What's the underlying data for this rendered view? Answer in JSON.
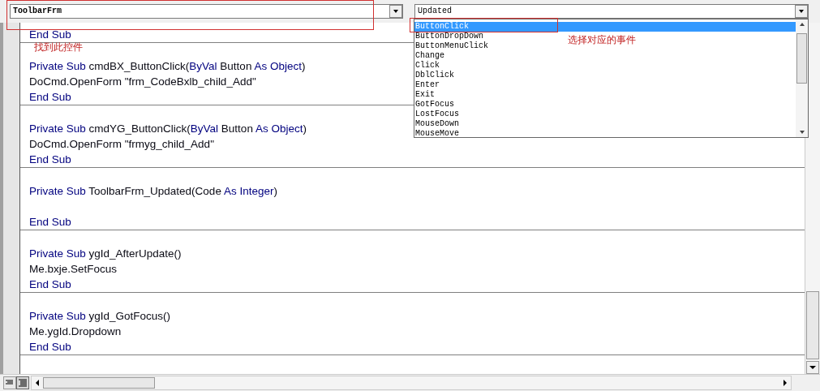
{
  "object_combo": {
    "value": "ToolbarFrm"
  },
  "event_combo": {
    "value": "Updated"
  },
  "event_list": [
    {
      "label": "ButtonClick",
      "selected": true
    },
    {
      "label": "ButtonDropDown",
      "selected": false
    },
    {
      "label": "ButtonMenuClick",
      "selected": false
    },
    {
      "label": "Change",
      "selected": false
    },
    {
      "label": "Click",
      "selected": false
    },
    {
      "label": "DblClick",
      "selected": false
    },
    {
      "label": "Enter",
      "selected": false
    },
    {
      "label": "Exit",
      "selected": false
    },
    {
      "label": "GotFocus",
      "selected": false
    },
    {
      "label": "LostFocus",
      "selected": false
    },
    {
      "label": "MouseDown",
      "selected": false
    },
    {
      "label": "MouseMove",
      "selected": false
    }
  ],
  "annotations": [
    {
      "text": "找到此控件"
    },
    {
      "text": "选择对应的事件"
    }
  ],
  "code_blocks": [
    {
      "kind": "fragment",
      "lines": [
        {
          "kind": "code",
          "segments": [
            {
              "text": "End Sub",
              "kind": "keyword"
            }
          ]
        }
      ]
    },
    {
      "kind": "procedure",
      "lines": [
        {
          "kind": "code",
          "segments": [
            {
              "text": "Private Sub",
              "kind": "keyword"
            },
            {
              "text": " cmdBX_ButtonClick(",
              "kind": "plain"
            },
            {
              "text": "ByVal",
              "kind": "keyword"
            },
            {
              "text": " Button ",
              "kind": "plain"
            },
            {
              "text": "As Object",
              "kind": "keyword"
            },
            {
              "text": ")",
              "kind": "plain"
            }
          ]
        },
        {
          "kind": "code",
          "segments": [
            {
              "text": "DoCmd.OpenForm \"frm_CodeBxlb_child_Add\"",
              "kind": "plain"
            }
          ]
        },
        {
          "kind": "code",
          "segments": [
            {
              "text": "End Sub",
              "kind": "keyword"
            }
          ]
        }
      ]
    },
    {
      "kind": "procedure",
      "lines": [
        {
          "kind": "code",
          "segments": [
            {
              "text": "Private Sub",
              "kind": "keyword"
            },
            {
              "text": " cmdYG_ButtonClick(",
              "kind": "plain"
            },
            {
              "text": "ByVal",
              "kind": "keyword"
            },
            {
              "text": " Button ",
              "kind": "plain"
            },
            {
              "text": "As Object",
              "kind": "keyword"
            },
            {
              "text": ")",
              "kind": "plain"
            }
          ]
        },
        {
          "kind": "code",
          "segments": [
            {
              "text": "DoCmd.OpenForm \"frmyg_child_Add\"",
              "kind": "plain"
            }
          ]
        },
        {
          "kind": "code",
          "segments": [
            {
              "text": "End Sub",
              "kind": "keyword"
            }
          ]
        }
      ]
    },
    {
      "kind": "procedure",
      "lines": [
        {
          "kind": "code",
          "segments": [
            {
              "text": "Private Sub",
              "kind": "keyword"
            },
            {
              "text": " ToolbarFrm_Updated(Code ",
              "kind": "plain"
            },
            {
              "text": "As Integer",
              "kind": "keyword"
            },
            {
              "text": ")",
              "kind": "plain"
            }
          ]
        },
        {
          "kind": "blank"
        },
        {
          "kind": "code",
          "segments": [
            {
              "text": "End Sub",
              "kind": "keyword"
            }
          ]
        }
      ]
    },
    {
      "kind": "procedure",
      "lines": [
        {
          "kind": "code",
          "segments": [
            {
              "text": "Private Sub",
              "kind": "keyword"
            },
            {
              "text": " ygId_AfterUpdate()",
              "kind": "plain"
            }
          ]
        },
        {
          "kind": "code",
          "segments": [
            {
              "text": "Me.bxje.SetFocus",
              "kind": "plain"
            }
          ]
        },
        {
          "kind": "code",
          "segments": [
            {
              "text": "End Sub",
              "kind": "keyword"
            }
          ]
        }
      ]
    },
    {
      "kind": "procedure",
      "lines": [
        {
          "kind": "code",
          "segments": [
            {
              "text": "Private Sub",
              "kind": "keyword"
            },
            {
              "text": " ygId_GotFocus()",
              "kind": "plain"
            }
          ]
        },
        {
          "kind": "code",
          "segments": [
            {
              "text": "Me.ygId.Dropdown",
              "kind": "plain"
            }
          ]
        },
        {
          "kind": "code",
          "segments": [
            {
              "text": "End Sub",
              "kind": "keyword"
            }
          ]
        }
      ]
    }
  ]
}
